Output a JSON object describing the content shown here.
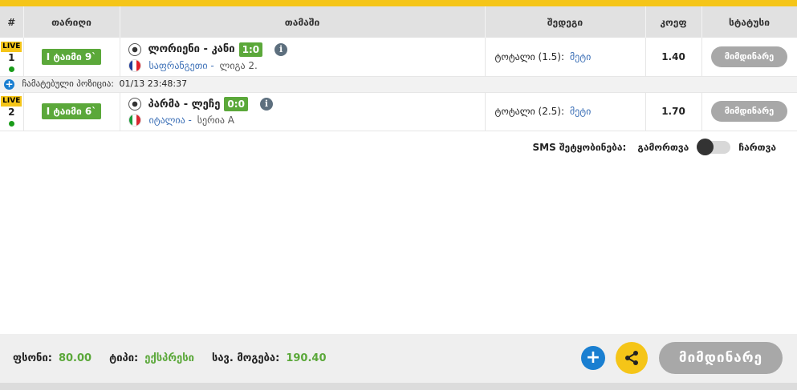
{
  "header": {
    "col_index": "#",
    "col_date": "თარიღი",
    "col_game": "თამაში",
    "col_market": "შედეგი",
    "col_odd": "კოეფ",
    "col_status": "სტატუსი"
  },
  "rows": [
    {
      "live": "LIVE",
      "num": "1",
      "time": "I ტაიმი 9`",
      "teams": "ლორიენი - კანი",
      "score": "1:0",
      "country": "საფრანგეთი",
      "sep": " - ",
      "league": "ლიგა 2.",
      "market_type": "ტოტალი (1.5):",
      "market_pick": "მეტი",
      "odd": "1.40",
      "status": "მიმდინარე",
      "flag": [
        "#1f3c99",
        "#ffffff",
        "#e0202a"
      ]
    },
    {
      "live": "LIVE",
      "num": "2",
      "time": "I ტაიმი 6`",
      "teams": "პარმა - ლეჩე",
      "score": "0:0",
      "country": "იტალია",
      "sep": " - ",
      "league": "სერია A",
      "market_type": "ტოტალი (2.5):",
      "market_pick": "მეტი",
      "odd": "1.70",
      "status": "მიმდინარე",
      "flag": [
        "#1a9c3a",
        "#ffffff",
        "#d9262f"
      ]
    }
  ],
  "fixation": {
    "label": "ჩამატებული პოზიცია:",
    "time": "01/13 23:48:37"
  },
  "sms": {
    "label": "SMS შეტყობინება:",
    "off_label": "გამორთვა",
    "on_label": "ჩართვა"
  },
  "footer": {
    "stake_label": "ფსონი:",
    "stake_value": "80.00",
    "type_label": "ტიპი:",
    "type_value": "ექსპრესი",
    "win_label": "სავ. მოგება:",
    "win_value": "190.40",
    "status_button": "მიმდინარე"
  },
  "colors": {
    "accent": "#f5c518",
    "green": "#5ba83a",
    "blue": "#1a7fd1",
    "link": "#3b6fb6",
    "status_grey": "#a8a8a8"
  },
  "icons": {
    "ball": "soccer-ball-icon",
    "info": "info-icon",
    "add": "plus-icon",
    "share": "share-icon"
  }
}
